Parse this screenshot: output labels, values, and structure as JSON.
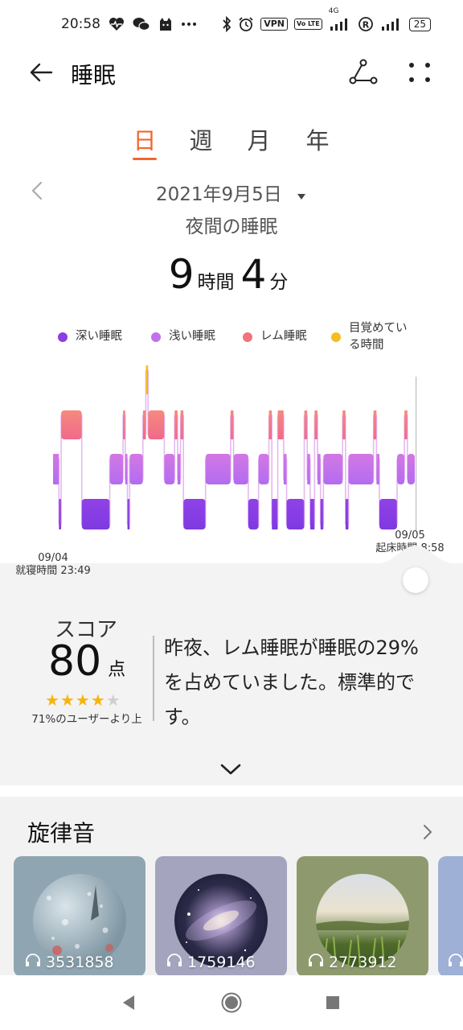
{
  "status_bar": {
    "time": "20:58",
    "battery": "25",
    "vpn": "VPN",
    "volte": "Vo LTE",
    "network": "4G",
    "icons": [
      "heart-rate-icon",
      "wechat-icon",
      "cat-icon",
      "ellipsis-icon",
      "bluetooth-icon",
      "alarm-icon",
      "vpn-icon",
      "volte-icon",
      "signal-icon",
      "registered-icon",
      "signal-icon",
      "battery-icon"
    ]
  },
  "header": {
    "title": "睡眠",
    "back_icon": "arrow-left-icon",
    "share_icon": "share-icon",
    "more_icon": "more-dots-icon"
  },
  "tabs": [
    {
      "label": "日",
      "active": true
    },
    {
      "label": "週",
      "active": false
    },
    {
      "label": "月",
      "active": false
    },
    {
      "label": "年",
      "active": false
    }
  ],
  "date_bar": {
    "date": "2021年9月5日",
    "dropdown_icon": "caret-down-icon",
    "prev_icon": "chevron-left-icon"
  },
  "subtitle": "夜間の睡眠",
  "duration": {
    "hours": "9",
    "hours_unit": "時間",
    "minutes": "4",
    "minutes_unit": "分"
  },
  "legend": [
    {
      "label": "深い睡眠",
      "color": "#8b3fe0"
    },
    {
      "label": "浅い睡眠",
      "color": "#c070ec"
    },
    {
      "label": "レム睡眠",
      "color": "#f2737a"
    },
    {
      "label": "目覚めている時間",
      "color": "#f5bd1e"
    }
  ],
  "chart_data": {
    "type": "hypnogram",
    "stages": [
      "awake",
      "rem",
      "light",
      "deep"
    ],
    "colors": {
      "awake": "#f5bd1e",
      "rem": "#f58a7e",
      "light": "#d378e4",
      "deep": "#8f42e6"
    },
    "start_date": "09/04",
    "start_label": "就寝時間 23:49",
    "end_date": "09/05",
    "end_label": "起床時間 8:58",
    "segments": [
      {
        "stage": "light",
        "width": 8
      },
      {
        "stage": "deep",
        "width": 3
      },
      {
        "stage": "rem",
        "width": 28
      },
      {
        "stage": "deep",
        "width": 38
      },
      {
        "stage": "light",
        "width": 18
      },
      {
        "stage": "rem",
        "width": 3
      },
      {
        "stage": "light",
        "width": 3
      },
      {
        "stage": "deep",
        "width": 3
      },
      {
        "stage": "light",
        "width": 18
      },
      {
        "stage": "rem",
        "width": 4
      },
      {
        "stage": "awake",
        "width": 3
      },
      {
        "stage": "rem",
        "width": 22
      },
      {
        "stage": "light",
        "width": 14
      },
      {
        "stage": "rem",
        "width": 4
      },
      {
        "stage": "light",
        "width": 4
      },
      {
        "stage": "rem",
        "width": 4
      },
      {
        "stage": "deep",
        "width": 30
      },
      {
        "stage": "light",
        "width": 34
      },
      {
        "stage": "rem",
        "width": 4
      },
      {
        "stage": "light",
        "width": 20
      },
      {
        "stage": "deep",
        "width": 14
      },
      {
        "stage": "light",
        "width": 14
      },
      {
        "stage": "rem",
        "width": 4
      },
      {
        "stage": "deep",
        "width": 8
      },
      {
        "stage": "rem",
        "width": 8
      },
      {
        "stage": "light",
        "width": 4
      },
      {
        "stage": "deep",
        "width": 24
      },
      {
        "stage": "rem",
        "width": 4
      },
      {
        "stage": "light",
        "width": 4
      },
      {
        "stage": "deep",
        "width": 6
      },
      {
        "stage": "rem",
        "width": 4
      },
      {
        "stage": "light",
        "width": 4
      },
      {
        "stage": "deep",
        "width": 4
      },
      {
        "stage": "light",
        "width": 26
      },
      {
        "stage": "rem",
        "width": 4
      },
      {
        "stage": "deep",
        "width": 4
      },
      {
        "stage": "light",
        "width": 34
      },
      {
        "stage": "rem",
        "width": 4
      },
      {
        "stage": "light",
        "width": 4
      },
      {
        "stage": "deep",
        "width": 24
      },
      {
        "stage": "light",
        "width": 10
      },
      {
        "stage": "rem",
        "width": 4
      },
      {
        "stage": "light",
        "width": 10
      }
    ]
  },
  "score": {
    "label": "スコア",
    "value": "80",
    "unit": "点",
    "stars_filled": 4,
    "stars_total": 5,
    "star_glyph": "★",
    "comparison": "71%のユーザーより上",
    "message": "昨夜、レム睡眠が睡眠の29%を占めていました。標準的です。",
    "expand_icon": "chevron-down-icon"
  },
  "music": {
    "title": "旋律音",
    "arrow_icon": "chevron-right-icon",
    "cards": [
      {
        "count": "3531858",
        "bg": "#8fa6b2",
        "art": "rain-window"
      },
      {
        "count": "1759146",
        "bg": "#a4a4bf",
        "art": "galaxy"
      },
      {
        "count": "2773912",
        "bg": "#8e9a6e",
        "art": "field"
      },
      {
        "count": "",
        "bg": "#9eb0d6",
        "art": "blue"
      }
    ],
    "card_icon": "headphones-icon"
  },
  "nav": {
    "back_icon": "triangle-back-icon",
    "home_icon": "circle-home-icon",
    "recent_icon": "square-recent-icon"
  }
}
